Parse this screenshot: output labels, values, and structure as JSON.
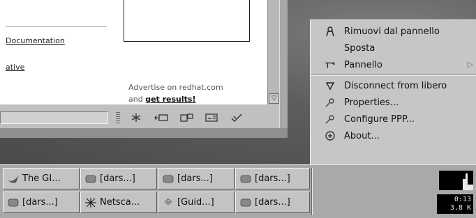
{
  "browser": {
    "links": {
      "documentation": "Documentation",
      "ative": "ative"
    },
    "ad": {
      "line1": "Advertise on redhat.com",
      "line2_prefix": "and ",
      "line2_link": "get results!"
    },
    "scroll_down_glyph": "▽",
    "component_bar": {
      "icons": [
        "navigator-icon",
        "mail-icon",
        "composer-icon",
        "address-book-icon",
        "security-icon"
      ]
    }
  },
  "menu": {
    "items": [
      {
        "label": "Rimuovi dal pannello",
        "icon": "remove-icon"
      },
      {
        "label": "Sposta",
        "icon": ""
      },
      {
        "label": "Pannello",
        "icon": "panel-icon",
        "submenu": true
      },
      {
        "label": "Disconnect from libero",
        "icon": "disconnect-icon"
      },
      {
        "label": "Properties...",
        "icon": "properties-icon"
      },
      {
        "label": "Configure PPP...",
        "icon": "configure-icon"
      },
      {
        "label": "About...",
        "icon": "about-icon"
      }
    ],
    "submenu_arrow": "▷"
  },
  "taskbar": {
    "tasks": [
      {
        "label": "The GI...",
        "icon": "gimp-icon"
      },
      {
        "label": "[dars...]",
        "icon": "terminal-icon"
      },
      {
        "label": "[dars...]",
        "icon": "terminal-icon"
      },
      {
        "label": "[dars...]",
        "icon": "terminal-icon"
      },
      {
        "label": "[dars...]",
        "icon": "terminal-icon"
      },
      {
        "label": "Netsca...",
        "icon": "netscape-icon"
      },
      {
        "label": "[Guid...]",
        "icon": "guide-icon"
      },
      {
        "label": "[dars...]",
        "icon": "terminal-icon"
      }
    ]
  },
  "ppp_applet": {
    "time": "0:13",
    "rate": "3.8 K"
  }
}
